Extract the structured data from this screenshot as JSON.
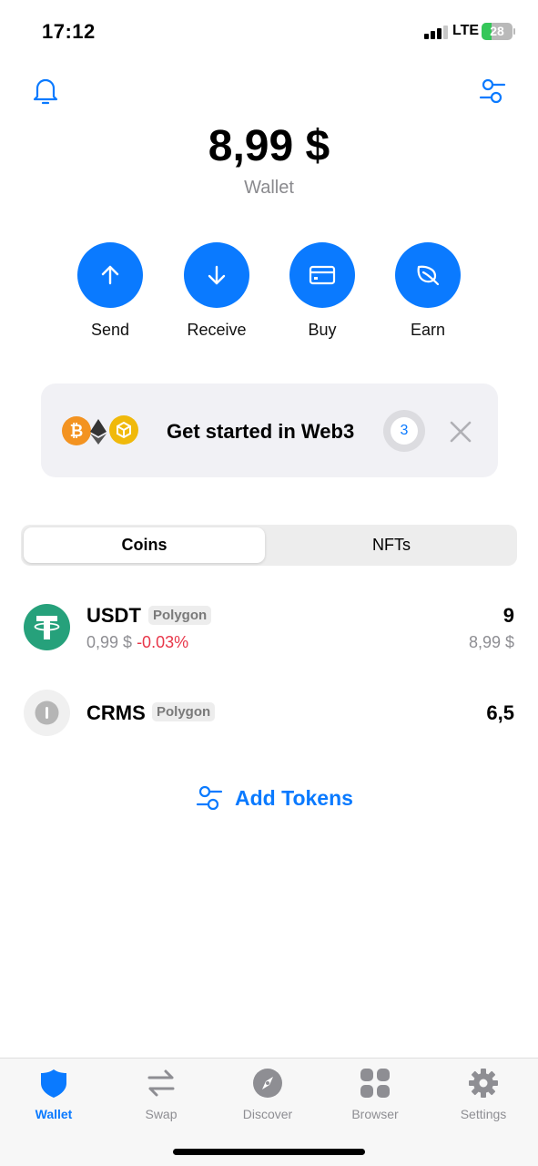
{
  "status": {
    "time": "17:12",
    "network": "LTE",
    "battery": "28"
  },
  "header": {
    "balance": "8,99 $",
    "wallet_name": "Wallet"
  },
  "actions": [
    {
      "label": "Send",
      "icon": "arrow-up-icon"
    },
    {
      "label": "Receive",
      "icon": "arrow-down-icon"
    },
    {
      "label": "Buy",
      "icon": "card-icon"
    },
    {
      "label": "Earn",
      "icon": "leaf-icon"
    }
  ],
  "banner": {
    "text": "Get started in Web3",
    "steps_count": "3",
    "btc_symbol": "₿"
  },
  "tabs": {
    "coins": "Coins",
    "nfts": "NFTs",
    "active": "Coins"
  },
  "tokens": [
    {
      "symbol": "USDT",
      "chain": "Polygon",
      "price": "0,99 $",
      "change": "-0.03%",
      "amount": "9",
      "fiat": "8,99 $",
      "color": "#26a17b"
    },
    {
      "symbol": "CRMS",
      "chain": "Polygon",
      "amount": "6,5",
      "color": "#f0f0f0"
    }
  ],
  "add_tokens": {
    "label": "Add Tokens"
  },
  "tabbar": [
    {
      "label": "Wallet",
      "active": true
    },
    {
      "label": "Swap",
      "active": false
    },
    {
      "label": "Discover",
      "active": false
    },
    {
      "label": "Browser",
      "active": false
    },
    {
      "label": "Settings",
      "active": false
    }
  ],
  "colors": {
    "accent": "#0a7aff",
    "negative": "#e8374a",
    "muted": "#8e8e93"
  }
}
